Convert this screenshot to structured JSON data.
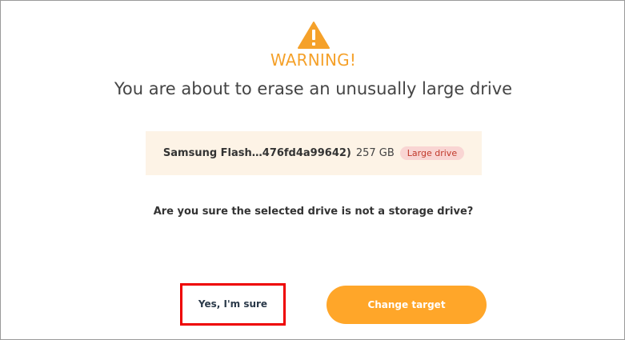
{
  "dialog": {
    "warning_label": "WARNING!",
    "headline": "You are about to erase an unusually large drive",
    "question": "Are you sure the selected drive is not a storage drive?"
  },
  "drive": {
    "name": "Samsung Flash…476fd4a99642)",
    "size": "257 GB",
    "badge": "Large drive"
  },
  "buttons": {
    "confirm_label": "Yes, I'm sure",
    "change_label": "Change target"
  },
  "colors": {
    "accent": "#ffa629",
    "warning": "#f5a12a",
    "badge_bg": "#f9d5d3",
    "badge_text": "#c0392b",
    "drive_box_bg": "#fdf3e6"
  },
  "icons": {
    "warning": "warning-triangle-icon"
  }
}
